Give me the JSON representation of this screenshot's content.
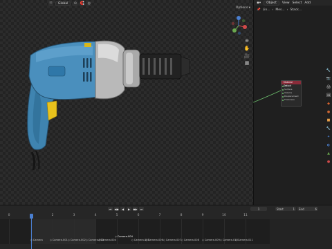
{
  "viewport": {
    "header": {
      "mode_label": "Global",
      "options_label": "Options"
    }
  },
  "right_panel": {
    "header": {
      "object_label": "Object",
      "menu_view": "View",
      "menu_select": "Select",
      "menu_add": "Add"
    },
    "breadcrumb": {
      "item1": "Lin...",
      "item2": "Mes...",
      "item3": "Stack..."
    },
    "node": {
      "title": "Material Output",
      "rows": [
        "All",
        "Surface",
        "Volume",
        "Displacement",
        "Thickness"
      ]
    }
  },
  "timeline": {
    "current_frame": "1",
    "start_label": "Start",
    "start_value": "1",
    "end_label": "End",
    "end_value": "6",
    "ticks": [
      "0",
      "1",
      "2",
      "3",
      "4",
      "5",
      "6",
      "7",
      "8",
      "9",
      "10",
      "11"
    ],
    "markers": [
      "Camera",
      "Camera.001",
      "Camera.002",
      "Camera.003",
      "Camera.004",
      "Camera.005",
      "Camera.006",
      "Camera.007",
      "Camera.008",
      "Camera.009",
      "Camera.010",
      "Camera.011",
      "Camera.012"
    ],
    "active_marker": "Camera.004"
  },
  "colors": {
    "accent_blue": "#4a7fd0",
    "node_header": "#8a2c3a",
    "drill_body": "#3f84b0",
    "drill_grip": "#1f5f8c",
    "trigger_yellow": "#e8c21c",
    "chrome": "#b9b9b9",
    "chuck": "#222222"
  }
}
